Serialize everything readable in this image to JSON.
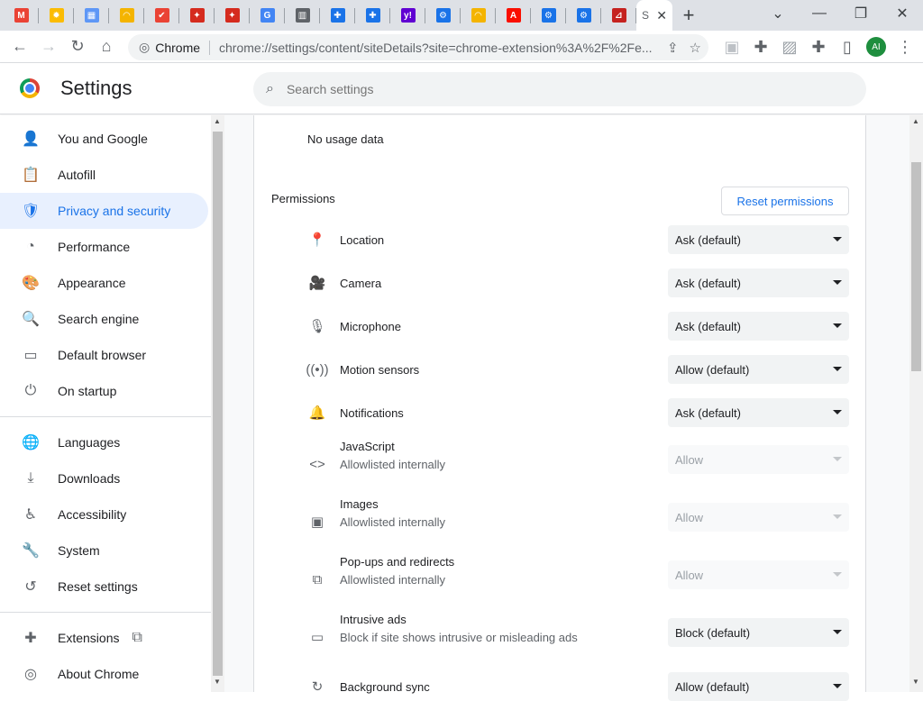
{
  "tabs": [
    {
      "icon": "gmail-icon",
      "color": "#ea4335",
      "glyph": "M"
    },
    {
      "icon": "sun-icon",
      "color": "#fbbc04",
      "glyph": "✹"
    },
    {
      "icon": "chart-icon",
      "color": "#5e97f6",
      "glyph": "▦"
    },
    {
      "icon": "rainbow-icon",
      "color": "#f4b400",
      "glyph": "◠"
    },
    {
      "icon": "ribbon-icon",
      "color": "#ea4335",
      "glyph": "✔"
    },
    {
      "icon": "maple-leaf-icon",
      "color": "#d52b1e",
      "glyph": "✦"
    },
    {
      "icon": "maple-leaf-icon",
      "color": "#d52b1e",
      "glyph": "✦"
    },
    {
      "icon": "google-icon",
      "color": "#4285f4",
      "glyph": "G"
    },
    {
      "icon": "building-icon",
      "color": "#5f6368",
      "glyph": "▥"
    },
    {
      "icon": "puzzle-icon",
      "color": "#1a73e8",
      "glyph": "✚"
    },
    {
      "icon": "puzzle-icon",
      "color": "#1a73e8",
      "glyph": "✚"
    },
    {
      "icon": "yahoo-icon",
      "color": "#6001d2",
      "glyph": "y!"
    },
    {
      "icon": "gear-icon",
      "color": "#1a73e8",
      "glyph": "⚙"
    },
    {
      "icon": "rainbow-icon",
      "color": "#f4b400",
      "glyph": "◠"
    },
    {
      "icon": "adobe-icon",
      "color": "#fa0f00",
      "glyph": "A"
    },
    {
      "icon": "gear-icon",
      "color": "#1a73e8",
      "glyph": "⚙"
    },
    {
      "icon": "gear-icon",
      "color": "#1a73e8",
      "glyph": "⚙"
    },
    {
      "icon": "pdf-icon",
      "color": "#c5221f",
      "glyph": "⊿"
    }
  ],
  "active_tab": {
    "title": "S",
    "close": "✕"
  },
  "newtab": "+",
  "window": {
    "minimize": "—",
    "restore": "❐",
    "close": "✕",
    "down": "⌄"
  },
  "toolbar": {
    "back": "←",
    "forward": "→",
    "reload": "↻",
    "home": "⌂"
  },
  "omnibox": {
    "site_label": "Chrome",
    "url": "chrome://settings/content/siteDetails?site=chrome-extension%3A%2F%2Fe..."
  },
  "profile": {
    "initials": "AI",
    "color": "#1e8e3e"
  },
  "settings": {
    "title": "Settings",
    "search_placeholder": "Search settings"
  },
  "nav": {
    "items": [
      {
        "label": "You and Google",
        "icon": "person-icon",
        "glyph": "👤"
      },
      {
        "label": "Autofill",
        "icon": "clipboard-icon",
        "glyph": "📋"
      },
      {
        "label": "Privacy and security",
        "icon": "shield-icon",
        "glyph": "🛡",
        "active": true
      },
      {
        "label": "Performance",
        "icon": "gauge-icon",
        "glyph": "◔"
      },
      {
        "label": "Appearance",
        "icon": "palette-icon",
        "glyph": "🎨"
      },
      {
        "label": "Search engine",
        "icon": "search-icon",
        "glyph": "🔍"
      },
      {
        "label": "Default browser",
        "icon": "browser-icon",
        "glyph": "▭"
      },
      {
        "label": "On startup",
        "icon": "power-icon",
        "glyph": "⏻"
      }
    ],
    "items2": [
      {
        "label": "Languages",
        "icon": "globe-icon",
        "glyph": "🌐"
      },
      {
        "label": "Downloads",
        "icon": "download-icon",
        "glyph": "⤓"
      },
      {
        "label": "Accessibility",
        "icon": "accessibility-icon",
        "glyph": "♿"
      },
      {
        "label": "System",
        "icon": "wrench-icon",
        "glyph": "🔧"
      },
      {
        "label": "Reset settings",
        "icon": "history-icon",
        "glyph": "↺"
      }
    ],
    "items3": [
      {
        "label": "Extensions",
        "icon": "puzzle-icon",
        "glyph": "✚"
      },
      {
        "label": "About Chrome",
        "icon": "chrome-icon",
        "glyph": "◎"
      }
    ]
  },
  "main": {
    "usage": "No usage data",
    "permissions_title": "Permissions",
    "reset_label": "Reset permissions",
    "permissions": [
      {
        "label": "Location",
        "sub": "",
        "value": "Ask (default)",
        "icon": "location-pin-icon",
        "glyph": "📍",
        "disabled": false
      },
      {
        "label": "Camera",
        "sub": "",
        "value": "Ask (default)",
        "icon": "camera-icon",
        "glyph": "🎥",
        "disabled": false
      },
      {
        "label": "Microphone",
        "sub": "",
        "value": "Ask (default)",
        "icon": "microphone-icon",
        "glyph": "🎙",
        "disabled": false
      },
      {
        "label": "Motion sensors",
        "sub": "",
        "value": "Allow (default)",
        "icon": "sensors-icon",
        "glyph": "((•))",
        "disabled": false
      },
      {
        "label": "Notifications",
        "sub": "",
        "value": "Ask (default)",
        "icon": "bell-icon",
        "glyph": "🔔",
        "disabled": false
      },
      {
        "label": "JavaScript",
        "sub": "Allowlisted internally",
        "value": "Allow",
        "icon": "code-icon",
        "glyph": "<>",
        "disabled": true
      },
      {
        "label": "Images",
        "sub": "Allowlisted internally",
        "value": "Allow",
        "icon": "image-icon",
        "glyph": "▣",
        "disabled": true
      },
      {
        "label": "Pop-ups and redirects",
        "sub": "Allowlisted internally",
        "value": "Allow",
        "icon": "popup-icon",
        "glyph": "⧉",
        "disabled": true
      },
      {
        "label": "Intrusive ads",
        "sub": "Block if site shows intrusive or misleading ads",
        "value": "Block (default)",
        "icon": "ads-icon",
        "glyph": "▭",
        "disabled": false
      },
      {
        "label": "Background sync",
        "sub": "",
        "value": "Allow (default)",
        "icon": "sync-icon",
        "glyph": "↻",
        "disabled": false
      }
    ]
  }
}
